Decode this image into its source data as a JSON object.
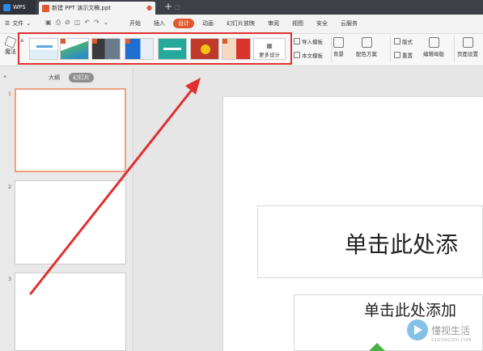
{
  "titlebar": {
    "app_label": "WPS",
    "doc_tab_label": "新建 PPT 演示文稿.ppt",
    "close_glyph": "●",
    "window_glyph": "▢",
    "add_tab_glyph": "+"
  },
  "menubar": {
    "file_label": "文件",
    "hamburger_glyph": "☰",
    "dropdown_glyph": "⌄",
    "quick_icons": [
      "▣",
      "⎙",
      "⊘",
      "◫",
      "↶",
      "↷",
      "⌄"
    ],
    "items": [
      {
        "label": "开始",
        "active": false
      },
      {
        "label": "插入",
        "active": false
      },
      {
        "label": "设计",
        "active": true
      },
      {
        "label": "动画",
        "active": false
      },
      {
        "label": "幻灯片放映",
        "active": false
      },
      {
        "label": "审阅",
        "active": false
      },
      {
        "label": "视图",
        "active": false
      },
      {
        "label": "安全",
        "active": false
      },
      {
        "label": "云服务",
        "active": false
      }
    ]
  },
  "ribbon": {
    "magic_label": "魔法",
    "gallery_up_glyph": "▲",
    "more_design_label": "更多设计",
    "more_design_glyph": "▦",
    "import_template_label": "导入模板",
    "text_template_label": "本文模板",
    "background_label": "背景",
    "color_scheme_label": "配色方案",
    "layout_label": "版式",
    "reset_label": "重置",
    "edit_master_label": "编辑母版",
    "page_setup_label": "页面设置"
  },
  "left_panel": {
    "collapse_glyph": "◂",
    "tab_outline": "大纲",
    "tab_slides": "幻灯片",
    "slide_numbers": [
      "1",
      "2",
      "3"
    ]
  },
  "slide": {
    "title_placeholder": "单击此处添",
    "subtitle_placeholder": "单击此处添加"
  },
  "watermark": {
    "text": "懂视生活",
    "sub": "51DONGSHI.COM"
  },
  "colors": {
    "accent": "#e0582d",
    "highlight_box": "#e03030",
    "arrow": "#e03030"
  }
}
